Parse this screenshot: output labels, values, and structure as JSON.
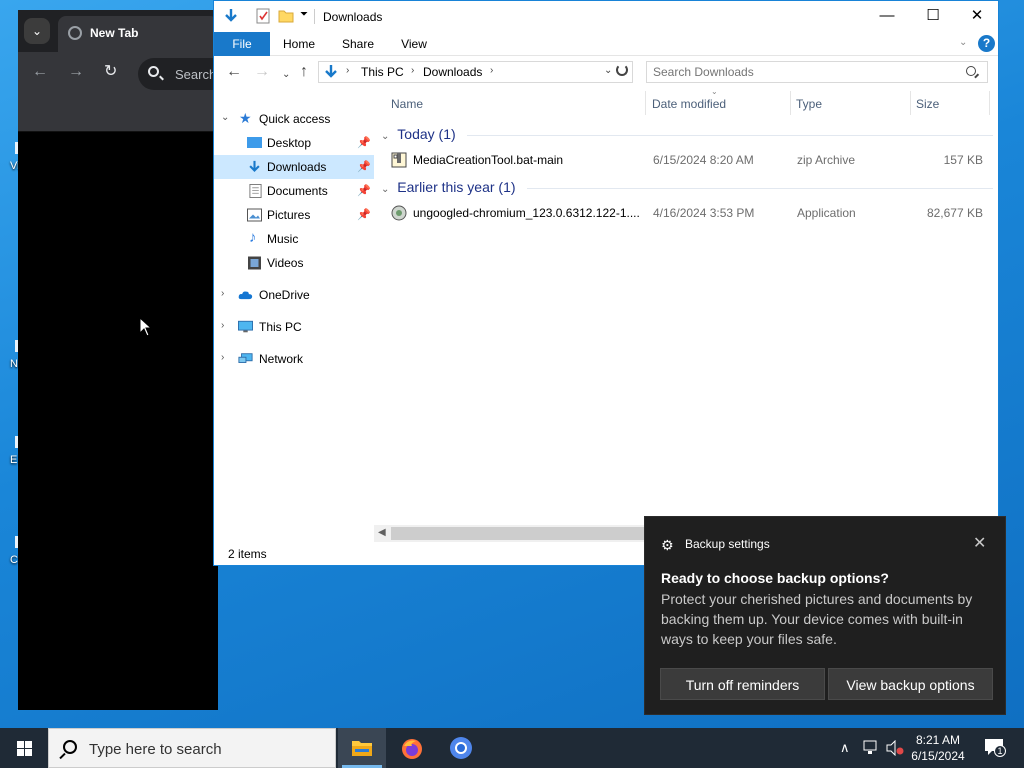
{
  "browser": {
    "tab_title": "New Tab",
    "search_placeholder": "Search"
  },
  "explorer": {
    "window_title": "Downloads",
    "ribbon_tabs": [
      "File",
      "Home",
      "Share",
      "View"
    ],
    "help_label": "?",
    "address": [
      "This PC",
      "Downloads"
    ],
    "search_placeholder": "Search Downloads",
    "nav": {
      "quick_access": "Quick access",
      "items": [
        "Desktop",
        "Downloads",
        "Documents",
        "Pictures",
        "Music",
        "Videos"
      ],
      "onedrive": "OneDrive",
      "this_pc": "This PC",
      "network": "Network"
    },
    "columns": [
      "Name",
      "Date modified",
      "Type",
      "Size"
    ],
    "groups": [
      {
        "label": "Today (1)",
        "files": [
          {
            "name": "MediaCreationTool.bat-main",
            "date": "6/15/2024 8:20 AM",
            "type": "zip Archive",
            "size": "157 KB"
          }
        ]
      },
      {
        "label": "Earlier this year (1)",
        "files": [
          {
            "name": "ungoogled-chromium_123.0.6312.122-1....",
            "date": "4/16/2024 3:53 PM",
            "type": "Application",
            "size": "82,677 KB"
          }
        ]
      }
    ],
    "status": "2 items"
  },
  "toast": {
    "app": "Backup settings",
    "heading": "Ready to choose backup options?",
    "body": "Protect your cherished pictures and documents by backing them up. Your device comes with built-in ways to keep your files safe.",
    "btn_off": "Turn off reminders",
    "btn_view": "View backup options"
  },
  "taskbar": {
    "search_placeholder": "Type here to search",
    "time": "8:21 AM",
    "date": "6/15/2024",
    "notification_count": "1"
  },
  "desktop_letters": [
    "Vi",
    "N",
    "E",
    "C"
  ],
  "colors": {
    "accent": "#1979ca",
    "selection": "#cce8ff",
    "group_header": "#1e3287",
    "toast_bg": "#1f1f1f",
    "taskbar_bg": "#1f2a36"
  }
}
